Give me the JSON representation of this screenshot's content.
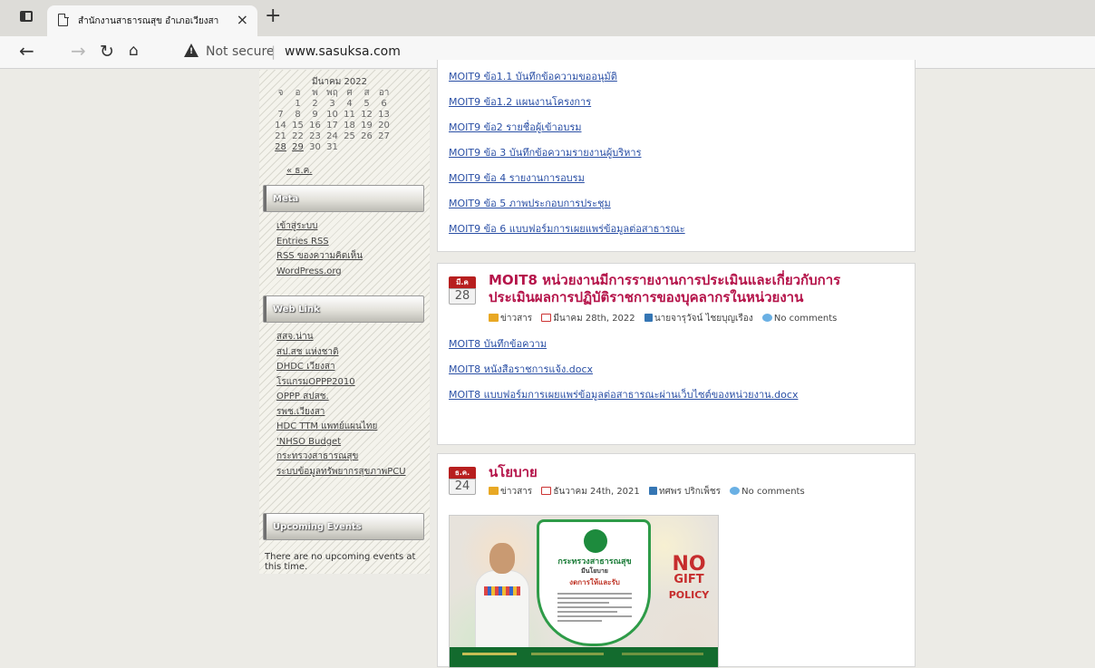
{
  "browser": {
    "tab_title": "สำนักงานสาธารณสุข อำเภอเวียงสา",
    "tab_close": "×",
    "new_tab": "+",
    "security_label": "Not secure",
    "separator": "|",
    "url": "www.sasuksa.com"
  },
  "sidebar": {
    "calendar": {
      "title": "มีนาคม 2022",
      "weekdays": [
        "จ",
        "อ",
        "พ",
        "พฤ",
        "ศ",
        "ส",
        "อา"
      ],
      "weeks": [
        [
          "",
          "1",
          "2",
          "3",
          "4",
          "5",
          "6"
        ],
        [
          "7",
          "8",
          "9",
          "10",
          "11",
          "12",
          "13"
        ],
        [
          "14",
          "15",
          "16",
          "17",
          "18",
          "19",
          "20"
        ],
        [
          "21",
          "22",
          "23",
          "24",
          "25",
          "26",
          "27"
        ],
        [
          "28",
          "29",
          "30",
          "31",
          "",
          "",
          ""
        ]
      ],
      "linked_days": [
        "28",
        "29"
      ],
      "prev_link": "« ธ.ค."
    },
    "meta": {
      "heading": "Meta",
      "links": [
        "เข้าสู่ระบบ",
        "Entries RSS",
        "RSS ของความคิดเห็น",
        "WordPress.org"
      ]
    },
    "weblink": {
      "heading": "Web Link",
      "links": [
        "สสจ.น่าน",
        "สป.สช แห่งชาติ",
        "DHDC เวียงสา",
        "โรแกรมOPPP2010",
        "OPPP สปสช.",
        "รพช.เวียงสา",
        "HDC TTM แพทย์แผนไทย",
        "'NHSO Budget",
        "กระทรวงสาธารณสุข",
        "ระบบข้อมูลทรัพยากรสุขภาพPCU"
      ]
    },
    "events": {
      "heading": "Upcoming Events",
      "text": "There are no upcoming events at this time."
    }
  },
  "main": {
    "doc_links": [
      "MOIT9 ข้อ1.1 บันทึกข้อความขออนุมัติ",
      "MOIT9 ข้อ1.2 แผนงานโครงการ",
      "MOIT9 ข้อ2 รายชื่อผู้เข้าอบรม",
      "MOIT9 ข้อ 3 บันทึกข้อความรายงานผู้บริหาร",
      "MOIT9 ข้อ 4 รายงานการอบรม",
      "MOIT9 ข้อ 5 ภาพประกอบการประชุม",
      "MOIT9 ข้อ 6 แบบฟอร์มการเผยแพร่ข้อมูลต่อสาธารณะ"
    ],
    "post1": {
      "month": "มี.ค",
      "day": "28",
      "title_line1": "MOIT8 หน่วยงานมีการรายงานการประเมินและเกี่ยวกับการ",
      "title_line2": "ประเมินผลการปฏิบัติราชการของบุคลากรในหน่วยงาน",
      "category": "ข่าวสาร",
      "date": "มีนาคม 28th, 2022",
      "author": "นายจารุวัจน์ ไชยบุญเรือง",
      "comments": "No comments",
      "links": [
        "MOIT8 บันทึกข้อความ",
        "MOIT8 หนังสือราชการแจ้ง.docx",
        "MOIT8 แบบฟอร์มการเผยแพร่ข้อมูลต่อสาธารณะผ่านเว็บไซต์ของหน่วยงาน.docx"
      ]
    },
    "post2": {
      "month": "ธ.ค.",
      "day": "24",
      "title": "นโยบาย",
      "category": "ข่าวสาร",
      "date": "ธันวาคม 24th, 2021",
      "author": "ทศพร ปริกเพ็ชร",
      "comments": "No comments",
      "poster": {
        "ministry": "กระทรวงสาธารณสุข",
        "policy": "มีนโยบาย",
        "no_gift_line": "งดการให้และรับ",
        "no_text": "NO",
        "gift_text": "GIFT",
        "policy_text": "POLICY"
      }
    }
  }
}
